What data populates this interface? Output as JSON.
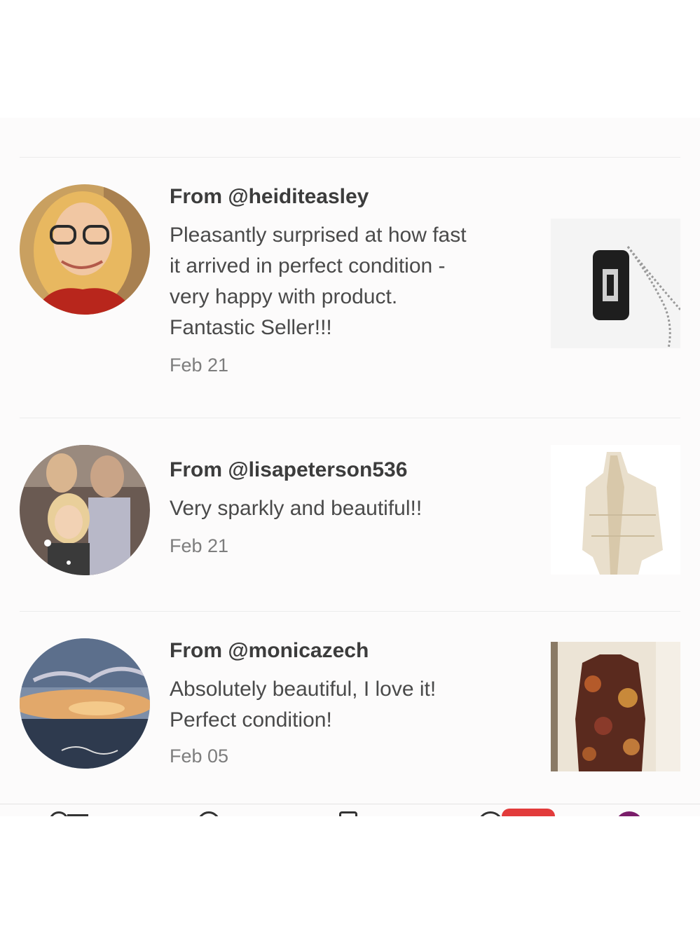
{
  "reviews": [
    {
      "author": "From @heiditeasley",
      "text_lines": [
        "Pleasantly surprised at how fast",
        "it arrived in perfect condition -",
        "very happy with product.",
        "Fantastic Seller!!!"
      ],
      "date": "Feb 21",
      "avatar": "woman-with-glasses-photo",
      "item_image": "dog-tag-necklace-photo"
    },
    {
      "author": "From @lisapeterson536",
      "text_lines": [
        "Very sparkly and beautiful!!"
      ],
      "date": "Feb 21",
      "avatar": "family-photo",
      "item_image": "beige-shawl-photo"
    },
    {
      "author": "From @monicazech",
      "text_lines": [
        "Absolutely beautiful, I love it!",
        "Perfect condition!"
      ],
      "date": "Feb 05",
      "avatar": "sunset-clouds-photo",
      "item_image": "floral-kimono-photo"
    }
  ],
  "tab_bar": {
    "tabs": [
      "shop-icon",
      "news-icon",
      "sell-icon",
      "inbox-icon",
      "profile-avatar"
    ],
    "badge_color": "#e23b3b"
  },
  "colors": {
    "background": "#fcfbfb",
    "text": "#3c3c3c",
    "muted": "#7d7d7d"
  }
}
